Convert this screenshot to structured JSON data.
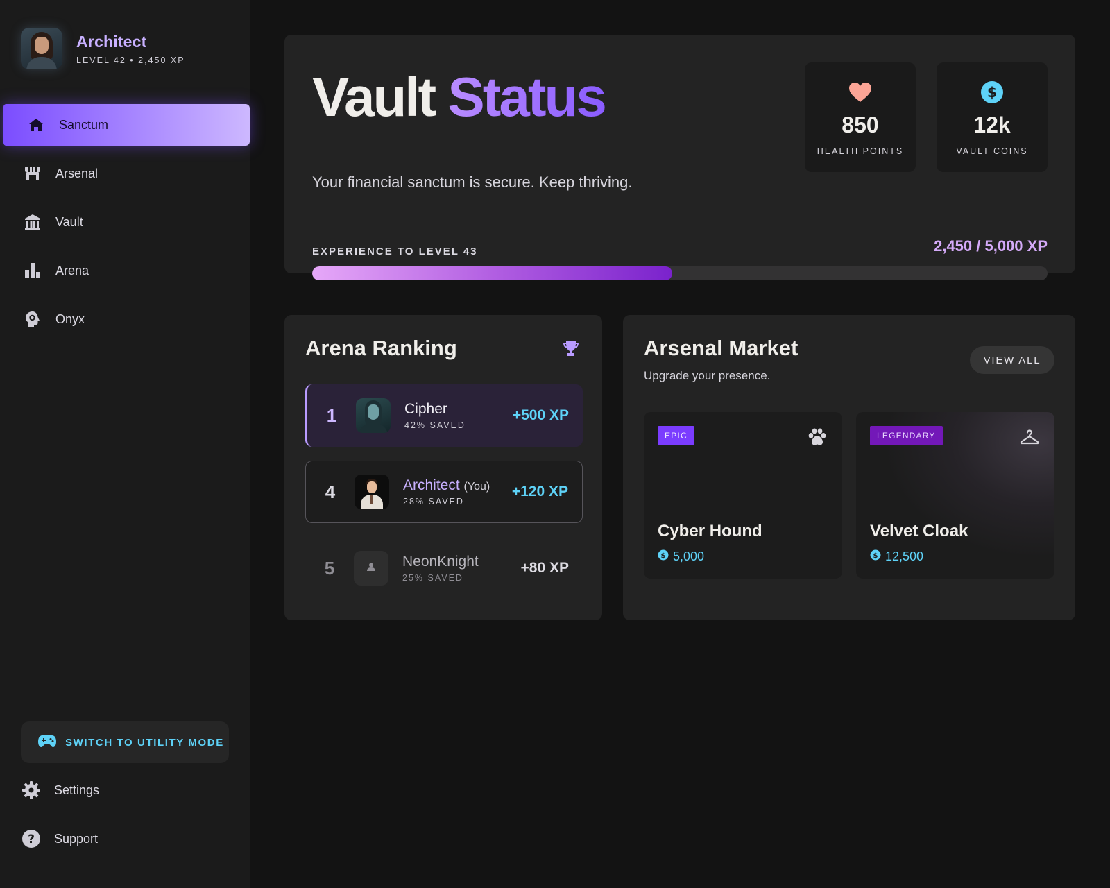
{
  "profile": {
    "name": "Architect",
    "level_line": "LEVEL 42 • 2,450 XP"
  },
  "nav": {
    "items": [
      {
        "label": "Sanctum",
        "icon": "home-icon",
        "active": true
      },
      {
        "label": "Arsenal",
        "icon": "storefront-icon"
      },
      {
        "label": "Vault",
        "icon": "bank-icon"
      },
      {
        "label": "Arena",
        "icon": "bar-chart-icon"
      },
      {
        "label": "Onyx",
        "icon": "brain-gear-icon"
      }
    ]
  },
  "mode_switch": {
    "label": "SWITCH TO UTILITY MODE",
    "icon": "gamepad-icon"
  },
  "bottom_nav": {
    "settings": "Settings",
    "support": "Support"
  },
  "hero": {
    "title_main": "Vault",
    "title_accent": "Status",
    "subtitle": "Your financial sanctum is secure. Keep thriving.",
    "stats": [
      {
        "value": "850",
        "label": "HEALTH POINTS",
        "icon": "heart-icon"
      },
      {
        "value": "12k",
        "label": "VAULT COINS",
        "icon": "coin-icon"
      }
    ],
    "xp_label": "EXPERIENCE TO LEVEL 43",
    "xp_value": "2,450 / 5,000 XP",
    "xp_progress": 0.49
  },
  "ranking": {
    "title": "Arena Ranking",
    "rows": [
      {
        "rank": "1",
        "name": "Cipher",
        "suffix": "",
        "saved": "42% SAVED",
        "xp": "+500 XP"
      },
      {
        "rank": "4",
        "name": "Architect",
        "suffix": "(You)",
        "saved": "28% SAVED",
        "xp": "+120 XP"
      },
      {
        "rank": "5",
        "name": "NeonKnight",
        "suffix": "",
        "saved": "25% SAVED",
        "xp": "+80 XP"
      }
    ]
  },
  "market": {
    "title": "Arsenal Market",
    "subtitle": "Upgrade your presence.",
    "view_all": "VIEW ALL",
    "items": [
      {
        "badge": "EPIC",
        "name": "Cyber Hound",
        "price": "5,000",
        "icon": "paw-icon"
      },
      {
        "badge": "LEGENDARY",
        "name": "Velvet Cloak",
        "price": "12,500",
        "icon": "hanger-icon"
      }
    ]
  },
  "colors": {
    "accent_purple": "#8a5cff",
    "accent_cyan": "#5ed2f7",
    "background": "#131313",
    "panel": "#232323"
  }
}
